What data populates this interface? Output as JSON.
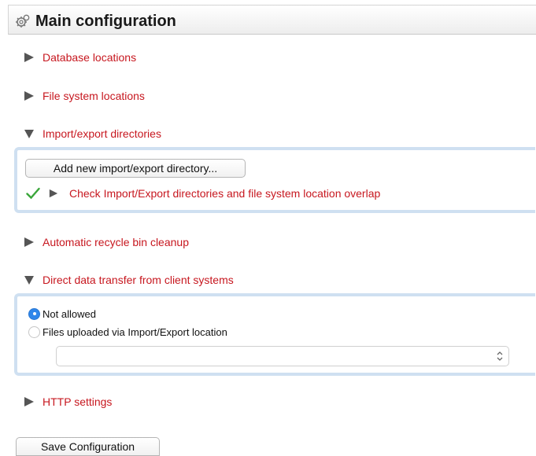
{
  "header": {
    "title": "Main configuration",
    "icon": "gears-icon"
  },
  "sections": {
    "database": "Database locations",
    "filesystem": "File system locations",
    "importexport": "Import/export directories",
    "recycle": "Automatic recycle bin cleanup",
    "direct": "Direct data transfer from client systems",
    "http": "HTTP settings"
  },
  "import_panel": {
    "add_button": "Add new import/export directory...",
    "check_label": "Check Import/Export directories and file system location overlap",
    "check_status": "ok"
  },
  "transfer_panel": {
    "options": [
      "Not allowed",
      "Files uploaded via Import/Export location"
    ],
    "selected": "Not allowed",
    "location_value": ""
  },
  "footer": {
    "save_button": "Save Configuration"
  },
  "colors": {
    "link": "#c7171f",
    "panel_border": "#cfe0f1",
    "check": "#3aa63a",
    "radio": "#2f86ea"
  }
}
